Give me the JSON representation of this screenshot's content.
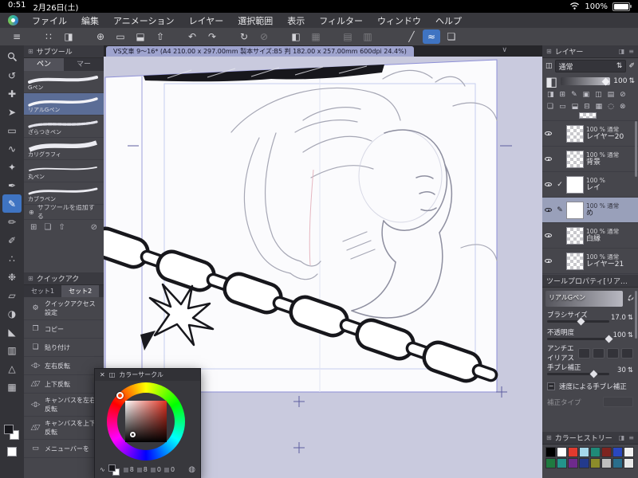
{
  "colors": {
    "accent": "#3f74c2",
    "selection": "#5b6d96",
    "canvas_bg": "#c9cade",
    "panel_bg": "#46464c"
  },
  "status_bar": {
    "time": "0:51",
    "date": "2月26日(土)",
    "battery": "100%"
  },
  "menu_bar": {
    "items": [
      "ファイル",
      "編集",
      "アニメーション",
      "レイヤー",
      "選択範囲",
      "表示",
      "フィルター",
      "ウィンドウ",
      "ヘルプ"
    ]
  },
  "tab_bar": {
    "document_title": "VS文車 9〜16* (A4 210.00 x 297.00mm 製本サイズ:B5 判 182.00 x 257.00mm 600dpi 24.4%)"
  },
  "icons": {
    "toolbar": {
      "menu": "≡",
      "workspace": "∷",
      "color_set": "◨",
      "new_file": "⊕",
      "open_file": "▭",
      "save_file": "⬓",
      "export": "⇧",
      "undo": "↶",
      "redo": "↷",
      "rotate": "↻",
      "deselect": "⊘",
      "fill": "◧",
      "grid": "▦",
      "snap_ruler": "▤",
      "snap_grid": "▥",
      "line": "╱",
      "curve": "≈",
      "material": "❏"
    },
    "left": {
      "rotate_view": "↺",
      "move": "✚",
      "object": "➤",
      "marquee": "▭",
      "lasso": "∿",
      "auto_select": "✦",
      "eyedropper": "✒",
      "pen": "✎",
      "pencil": "✏",
      "brush": "✐",
      "airbrush": "∴",
      "decoration": "❉",
      "eraser": "▱",
      "blend": "◑",
      "fill": "◣",
      "gradient": "▥",
      "figure": "△",
      "frame": "▦"
    },
    "ui": {
      "close": "✕",
      "chevron_down": "∨",
      "stepper": "⇅",
      "add": "⊕",
      "check": "✓",
      "edit": "✎",
      "minus": "−",
      "dots": "∷",
      "grid": "⊞",
      "panel_a": "◨",
      "panel_b": "≡",
      "trash": "⊘",
      "folder": "❏",
      "up": "⇧",
      "mix": "◍",
      "wave": "∿",
      "small_sq": "◫",
      "brush": "✐",
      "opacity": "◧"
    },
    "quick": {
      "gear": "⚙",
      "copy": "❐",
      "paste": "❏",
      "flip_h": "◁▷",
      "flip_v": "△▽",
      "menu": "▭"
    },
    "layer_cmd_row1": [
      "◨",
      "⊞",
      "✎",
      "▣",
      "◫",
      "▤",
      "⊘"
    ],
    "layer_cmd_row2": [
      "❏",
      "▭",
      "⬓",
      "⊟",
      "▦",
      "◌",
      "⊗"
    ]
  },
  "subtool_panel": {
    "title": "サブツール",
    "tab_pen": "ペン",
    "tab_marker": "マー",
    "tools": [
      {
        "name": "Gペン"
      },
      {
        "name": "リアルGペン"
      },
      {
        "name": "ざらつきペン"
      },
      {
        "name": "カリグラフィ"
      },
      {
        "name": "丸ペン"
      },
      {
        "name": "カブラペン"
      }
    ],
    "add_label": "サブツールを追加する"
  },
  "quick_access": {
    "title": "クイックアク",
    "tab1": "セット1",
    "tab2": "セット2",
    "items": [
      {
        "label": "クイックアクセス設定"
      },
      {
        "label": "コピー"
      },
      {
        "label": "貼り付け"
      },
      {
        "label": "左右反転"
      },
      {
        "label": "上下反転"
      },
      {
        "label": "キャンバスを左右反転"
      },
      {
        "label": "キャンバスを上下反転"
      },
      {
        "label": "メニューバーを"
      }
    ]
  },
  "layers_panel": {
    "title": "レイヤー",
    "blend_mode": "通常",
    "opacity": "100",
    "layers": [
      {
        "info": "100 % 通常",
        "name": "レイヤー20"
      },
      {
        "info": "100 % 通常",
        "name": "背景"
      },
      {
        "info": "100 %",
        "name": "レイ"
      },
      {
        "info": "100 % 通常",
        "name": "め"
      },
      {
        "info": "100 % 通常",
        "name": "白縁"
      },
      {
        "info": "100 % 通常",
        "name": "レイヤー21"
      }
    ]
  },
  "tool_property": {
    "title": "ツールプロパティ[リアルGペン]",
    "tool_name": "リアルGペン",
    "brush_size_label": "ブラシサイズ",
    "brush_size_value": "17.0",
    "opacity_label": "不透明度",
    "opacity_value": "100",
    "antialias_label": "アンチエイリアス",
    "stabilization_label": "手ブレ補正",
    "stabilization_value": "30",
    "speed_stabilization_label": "速度による手ブレ補正",
    "correction_type_label": "補正タイプ"
  },
  "color_history": {
    "title": "カラーヒストリー",
    "swatches": [
      "#000000",
      "#ffffff",
      "#e23a2e",
      "#a6d8ea",
      "#1f8a78",
      "#7e2420",
      "#2a48c0",
      "#f2f2f2",
      "#1f7a40",
      "#23948c",
      "#6e2a8c",
      "#233a8c",
      "#8c8c2a",
      "#bfbfbf",
      "#2a6e8c",
      "#e8e8e8"
    ]
  },
  "color_wheel": {
    "title": "カラーサークル",
    "values": [
      "8",
      "8",
      "0",
      "0"
    ]
  },
  "color_chips": {
    "main": "#17171c",
    "sub": "#ffffff"
  }
}
